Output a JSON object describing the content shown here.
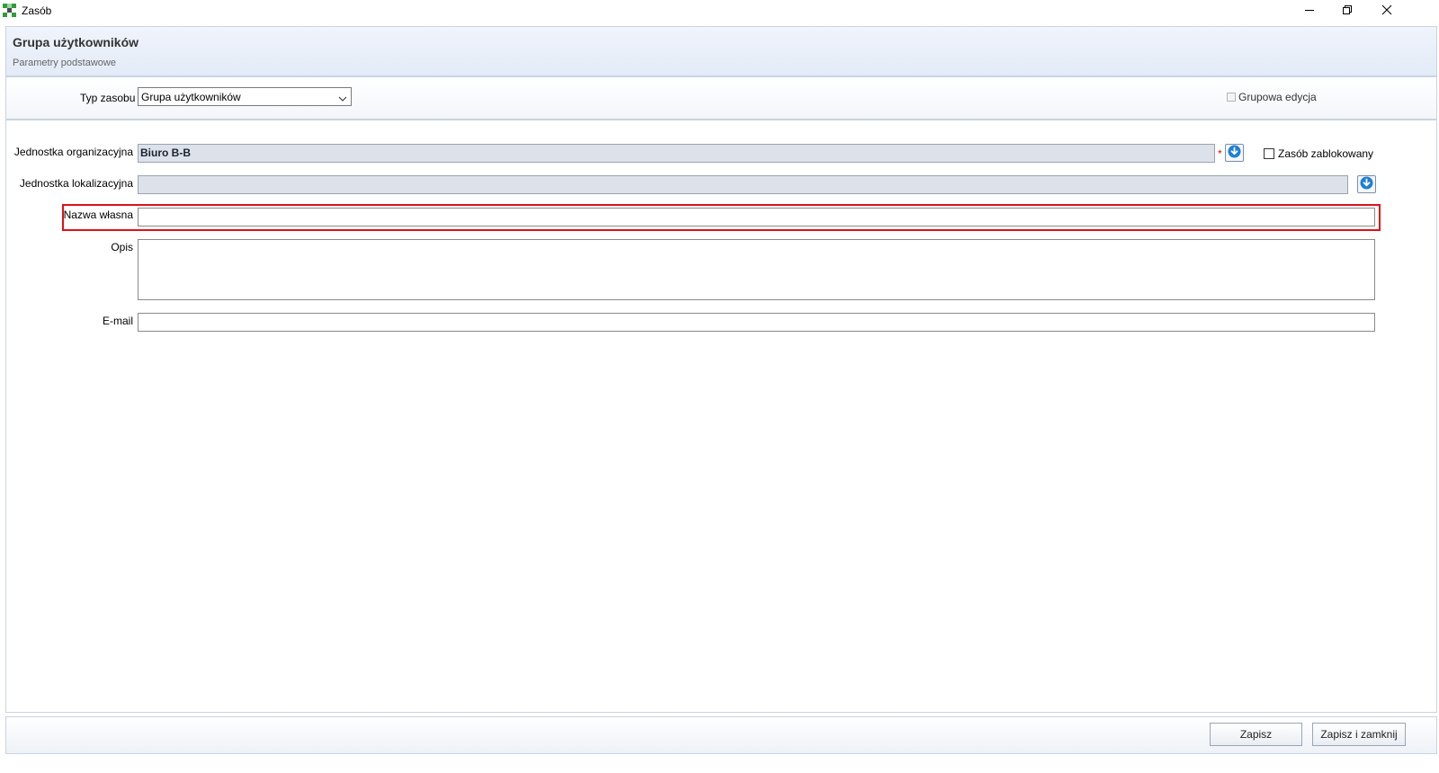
{
  "window": {
    "title": "Zasób",
    "controls": [
      "minimize-icon",
      "restore-icon",
      "close-icon"
    ]
  },
  "header": {
    "title": "Grupa użytkowników",
    "subtitle": "Parametry podstawowe"
  },
  "type_row": {
    "label": "Typ zasobu",
    "selected": "Grupa użytkowników",
    "group_edit_label": "Grupowa edycja",
    "group_edit_checked": false
  },
  "form": {
    "org_unit": {
      "label": "Jednostka organizacyjna",
      "value": "Biuro B-B",
      "required_mark": "*"
    },
    "blocked": {
      "label": "Zasób zablokowany",
      "checked": false
    },
    "location_unit": {
      "label": "Jednostka lokalizacyjna",
      "value": ""
    },
    "own_name": {
      "label": "Nazwa własna",
      "value": ""
    },
    "description": {
      "label": "Opis",
      "value": ""
    },
    "email": {
      "label": "E-mail",
      "value": ""
    }
  },
  "footer": {
    "save_label": "Zapisz",
    "save_close_label": "Zapisz i zamknij"
  },
  "colors": {
    "highlight": "#e0101a",
    "lookup_icon": "#1f7fd6",
    "readonly_field": "#dde2ea",
    "header_bg": "#e3ebf7"
  }
}
